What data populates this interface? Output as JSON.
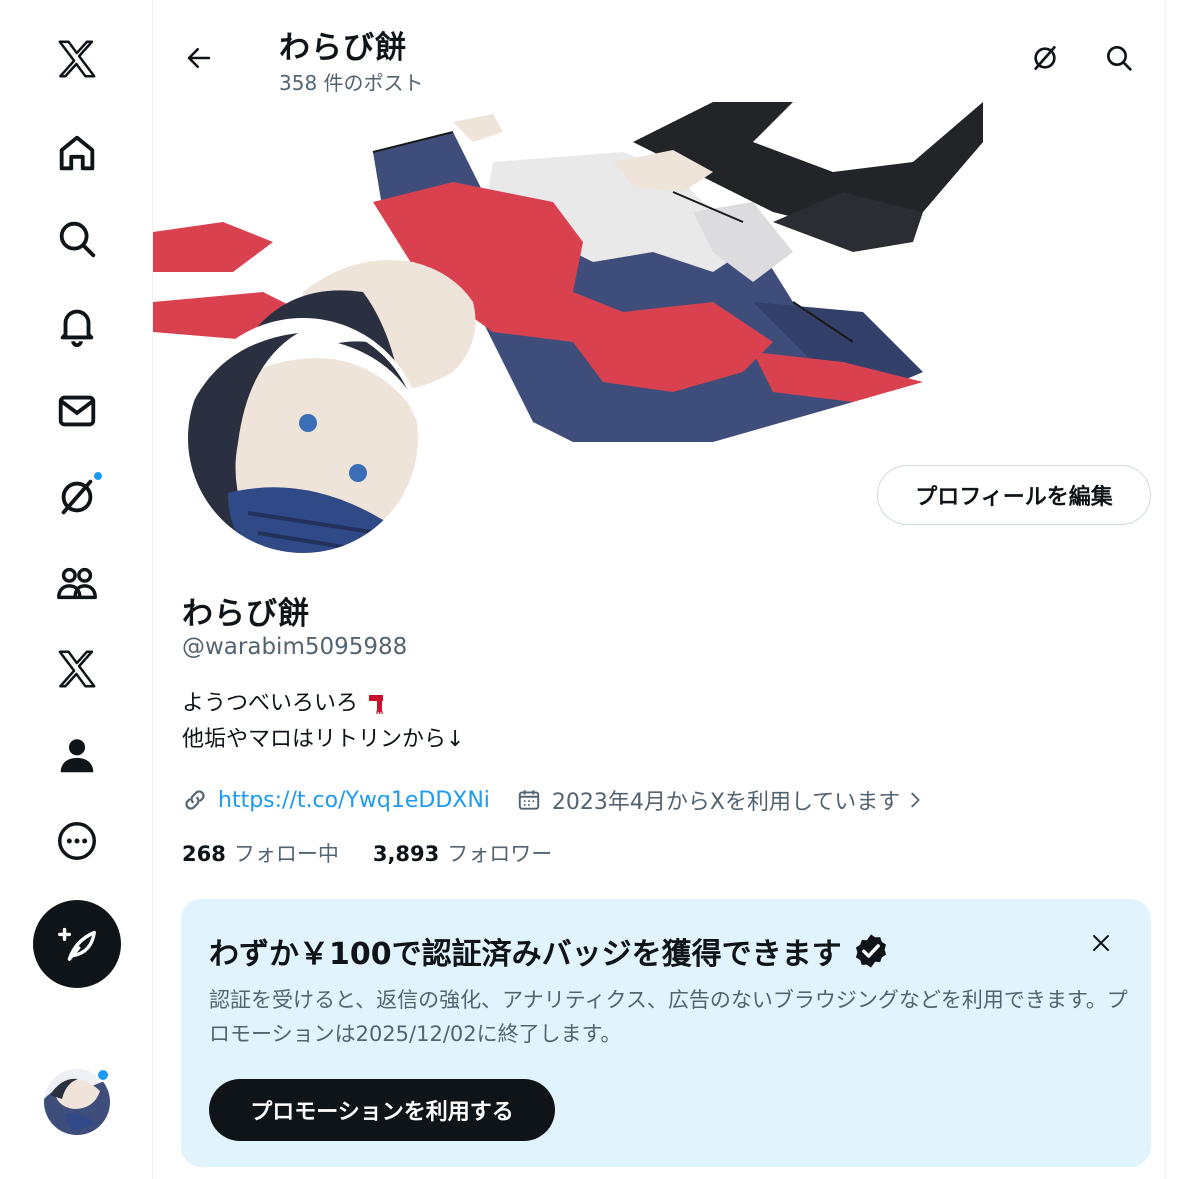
{
  "header": {
    "name": "わらび餅",
    "post_count": "358 件のポスト"
  },
  "profile": {
    "name": "わらび餅",
    "handle": "@warabim5095988",
    "bio_line1": "ようつべいろいろ",
    "bio_emoji": "scarf-emoji",
    "bio_line2": "他垢やマロはリトリンから↓",
    "link": "https://t.co/Ywq1eDDXNi",
    "joined": "2023年4月からXを利用しています",
    "edit_label": "プロフィールを編集"
  },
  "stats": {
    "following_count": "268",
    "following_label": "フォロー中",
    "followers_count": "3,893",
    "followers_label": "フォロワー"
  },
  "promo": {
    "title": "わずか￥100で認証済みバッジを獲得できます",
    "text": "認証を受けると、返信の強化、アナリティクス、広告のないブラウジングなどを利用できます。プロモーションは2025/12/02に終了します。",
    "button": "プロモーションを利用する"
  },
  "nav": {
    "items": [
      "x-logo-icon",
      "home-icon",
      "search-icon",
      "bell-icon",
      "mail-icon",
      "grok-icon",
      "communities-icon",
      "x-premium-icon",
      "profile-icon",
      "more-icon"
    ]
  },
  "colors": {
    "accent": "#1d9bf0",
    "text": "#0f1419",
    "muted": "#536471",
    "promo_bg": "#e1f4fe",
    "scarf_red": "#d9414f",
    "coat_navy": "#3e4d7a"
  }
}
